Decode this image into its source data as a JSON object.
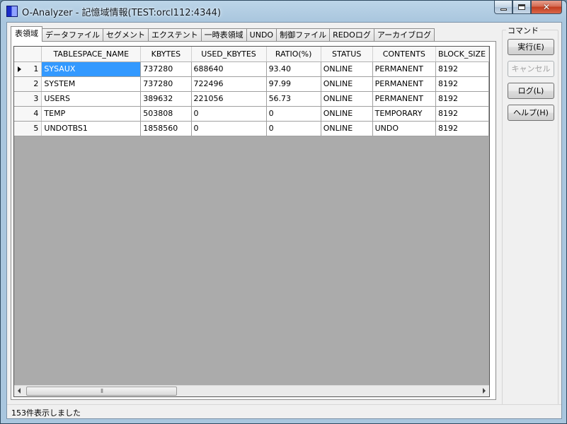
{
  "window": {
    "title": "O-Analyzer - 記憶域情報(TEST:orcl112:4344)",
    "close_glyph": "✕"
  },
  "tabs": [
    {
      "label": "表領域",
      "active": true
    },
    {
      "label": "データファイル"
    },
    {
      "label": "セグメント"
    },
    {
      "label": "エクステント"
    },
    {
      "label": "一時表領域"
    },
    {
      "label": "UNDO"
    },
    {
      "label": "制御ファイル"
    },
    {
      "label": "REDOログ"
    },
    {
      "label": "アーカイブログ"
    }
  ],
  "grid": {
    "columns": [
      "TABLESPACE_NAME",
      "KBYTES",
      "USED_KBYTES",
      "RATIO(%)",
      "STATUS",
      "CONTENTS",
      "BLOCK_SIZE"
    ],
    "rows": [
      {
        "num": "1",
        "cells": [
          "SYSAUX",
          "737280",
          "688640",
          "93.40",
          "ONLINE",
          "PERMANENT",
          "8192"
        ]
      },
      {
        "num": "2",
        "cells": [
          "SYSTEM",
          "737280",
          "722496",
          "97.99",
          "ONLINE",
          "PERMANENT",
          "8192"
        ]
      },
      {
        "num": "3",
        "cells": [
          "USERS",
          "389632",
          "221056",
          "56.73",
          "ONLINE",
          "PERMANENT",
          "8192"
        ]
      },
      {
        "num": "4",
        "cells": [
          "TEMP",
          "503808",
          "0",
          "0",
          "ONLINE",
          "TEMPORARY",
          "8192"
        ]
      },
      {
        "num": "5",
        "cells": [
          "UNDOTBS1",
          "1858560",
          "0",
          "0",
          "ONLINE",
          "UNDO",
          "8192"
        ]
      }
    ],
    "current_row": 1,
    "scroll_thumb_grip": "⦀"
  },
  "commands": {
    "legend": "コマンド",
    "execute": "実行(E)",
    "cancel": "キャンセル",
    "log": "ログ(L)",
    "help": "ヘルプ(H)"
  },
  "status": {
    "message": "153件表示しました"
  },
  "colors": {
    "selection": "#3399ff",
    "grid_empty_area": "#ababab",
    "title_bar": "#bcd5e8"
  }
}
